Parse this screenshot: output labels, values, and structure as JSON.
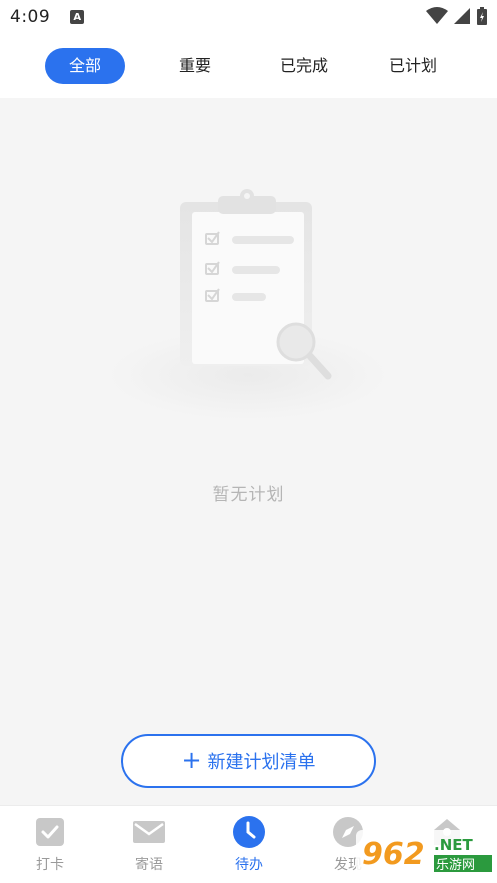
{
  "status_bar": {
    "time": "4:09",
    "notification_icon": "a-letter-icon",
    "icons": [
      "wifi-icon",
      "signal-icon",
      "battery-icon"
    ]
  },
  "tabs": [
    {
      "label": "全部",
      "active": true
    },
    {
      "label": "重要",
      "active": false
    },
    {
      "label": "已完成",
      "active": false
    },
    {
      "label": "已计划",
      "active": false
    }
  ],
  "empty_state": {
    "icon": "clipboard-checklist-icon",
    "message": "暂无计划"
  },
  "create_button": {
    "icon": "plus-icon",
    "label": "新建计划清单"
  },
  "bottom_nav": [
    {
      "label": "打卡",
      "icon": "checkbox-icon",
      "active": false
    },
    {
      "label": "寄语",
      "icon": "envelope-icon",
      "active": false
    },
    {
      "label": "待办",
      "icon": "clock-icon",
      "active": true
    },
    {
      "label": "发现",
      "icon": "compass-icon",
      "active": false
    },
    {
      "label": "",
      "icon": "home-icon",
      "active": false
    }
  ],
  "watermark": {
    "number": "962",
    "suffix": ".NET",
    "caption": "乐游网"
  },
  "colors": {
    "accent": "#2b72ee",
    "background": "#f5f5f5",
    "inactive": "#9a9a9a"
  }
}
